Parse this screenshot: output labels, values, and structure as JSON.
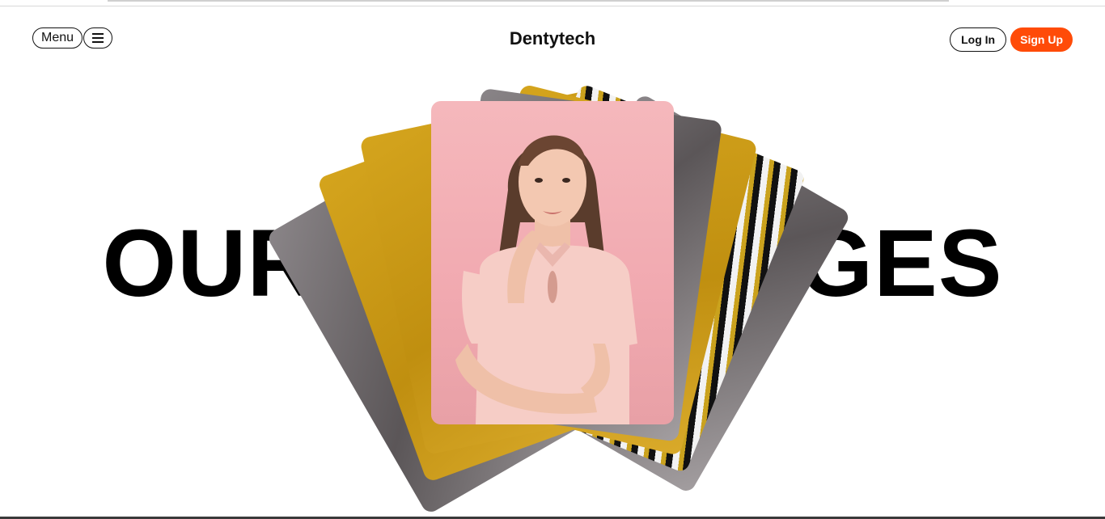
{
  "nav": {
    "menu_label": "Menu",
    "brand": "Dentytech",
    "login_label": "Log In",
    "signup_label": "Sign Up",
    "icons": {
      "hamburger": "hamburger-icon"
    }
  },
  "hero": {
    "headline": "OUR ADVANTAGES",
    "image_alt": "smiling woman in pink blouse"
  },
  "colors": {
    "accent": "#ff4b08",
    "text": "#000000",
    "background": "#ffffff",
    "card_pink": "#f5b8bc",
    "card_gold": "#c99a17"
  }
}
